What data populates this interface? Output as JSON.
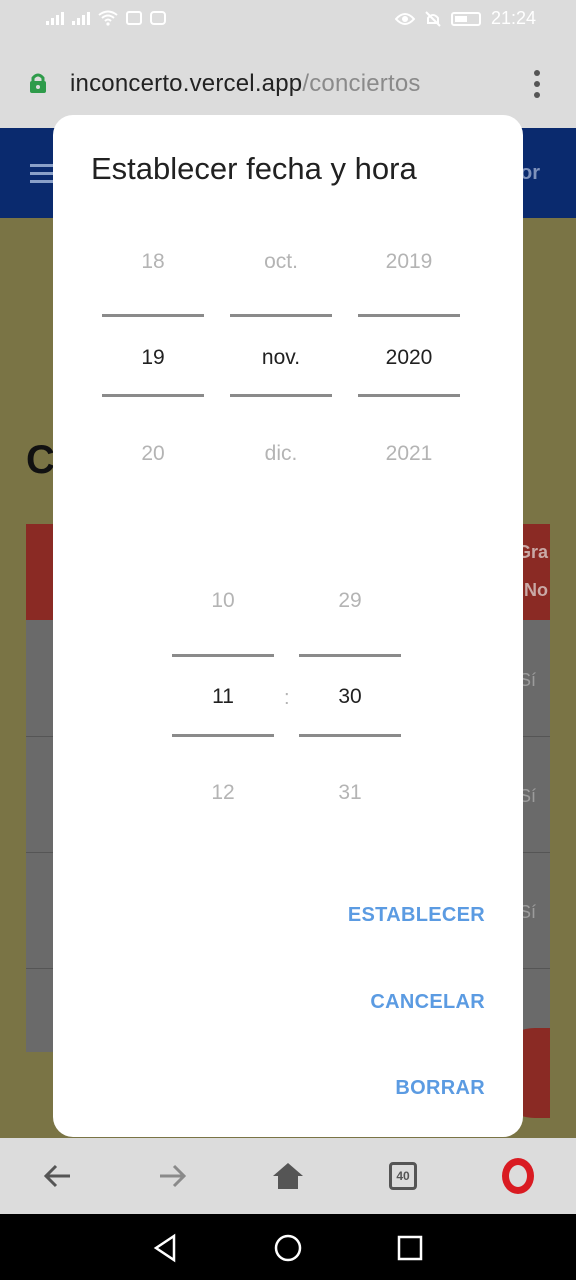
{
  "status_bar": {
    "time": "21:24"
  },
  "address_bar": {
    "url_host": "inconcerto.vercel.app",
    "url_path": "/conciertos"
  },
  "background_page": {
    "header_partial_text": "or",
    "title_partial": "C",
    "table_head_partial": [
      "Gra",
      "No"
    ],
    "row_values_partial": [
      "Sí",
      "Sí",
      "Sí"
    ]
  },
  "dialog": {
    "title": "Establecer fecha y hora",
    "date_picker": {
      "day": {
        "prev": "18",
        "selected": "19",
        "next": "20"
      },
      "month": {
        "prev": "oct.",
        "selected": "nov.",
        "next": "dic."
      },
      "year": {
        "prev": "2019",
        "selected": "2020",
        "next": "2021"
      }
    },
    "time_picker": {
      "hour": {
        "prev": "10",
        "selected": "11",
        "next": "12"
      },
      "separator": ":",
      "minute": {
        "prev": "29",
        "selected": "30",
        "next": "31"
      }
    },
    "actions": {
      "set_label": "ESTABLECER",
      "cancel_label": "CANCELAR",
      "clear_label": "BORRAR"
    }
  },
  "toolbar": {
    "tabs_count": "40"
  },
  "colors": {
    "accent": "#5b9be2",
    "lock": "#2e9b4a",
    "opera": "#d91b22",
    "app_header": "#0a2a6e"
  }
}
